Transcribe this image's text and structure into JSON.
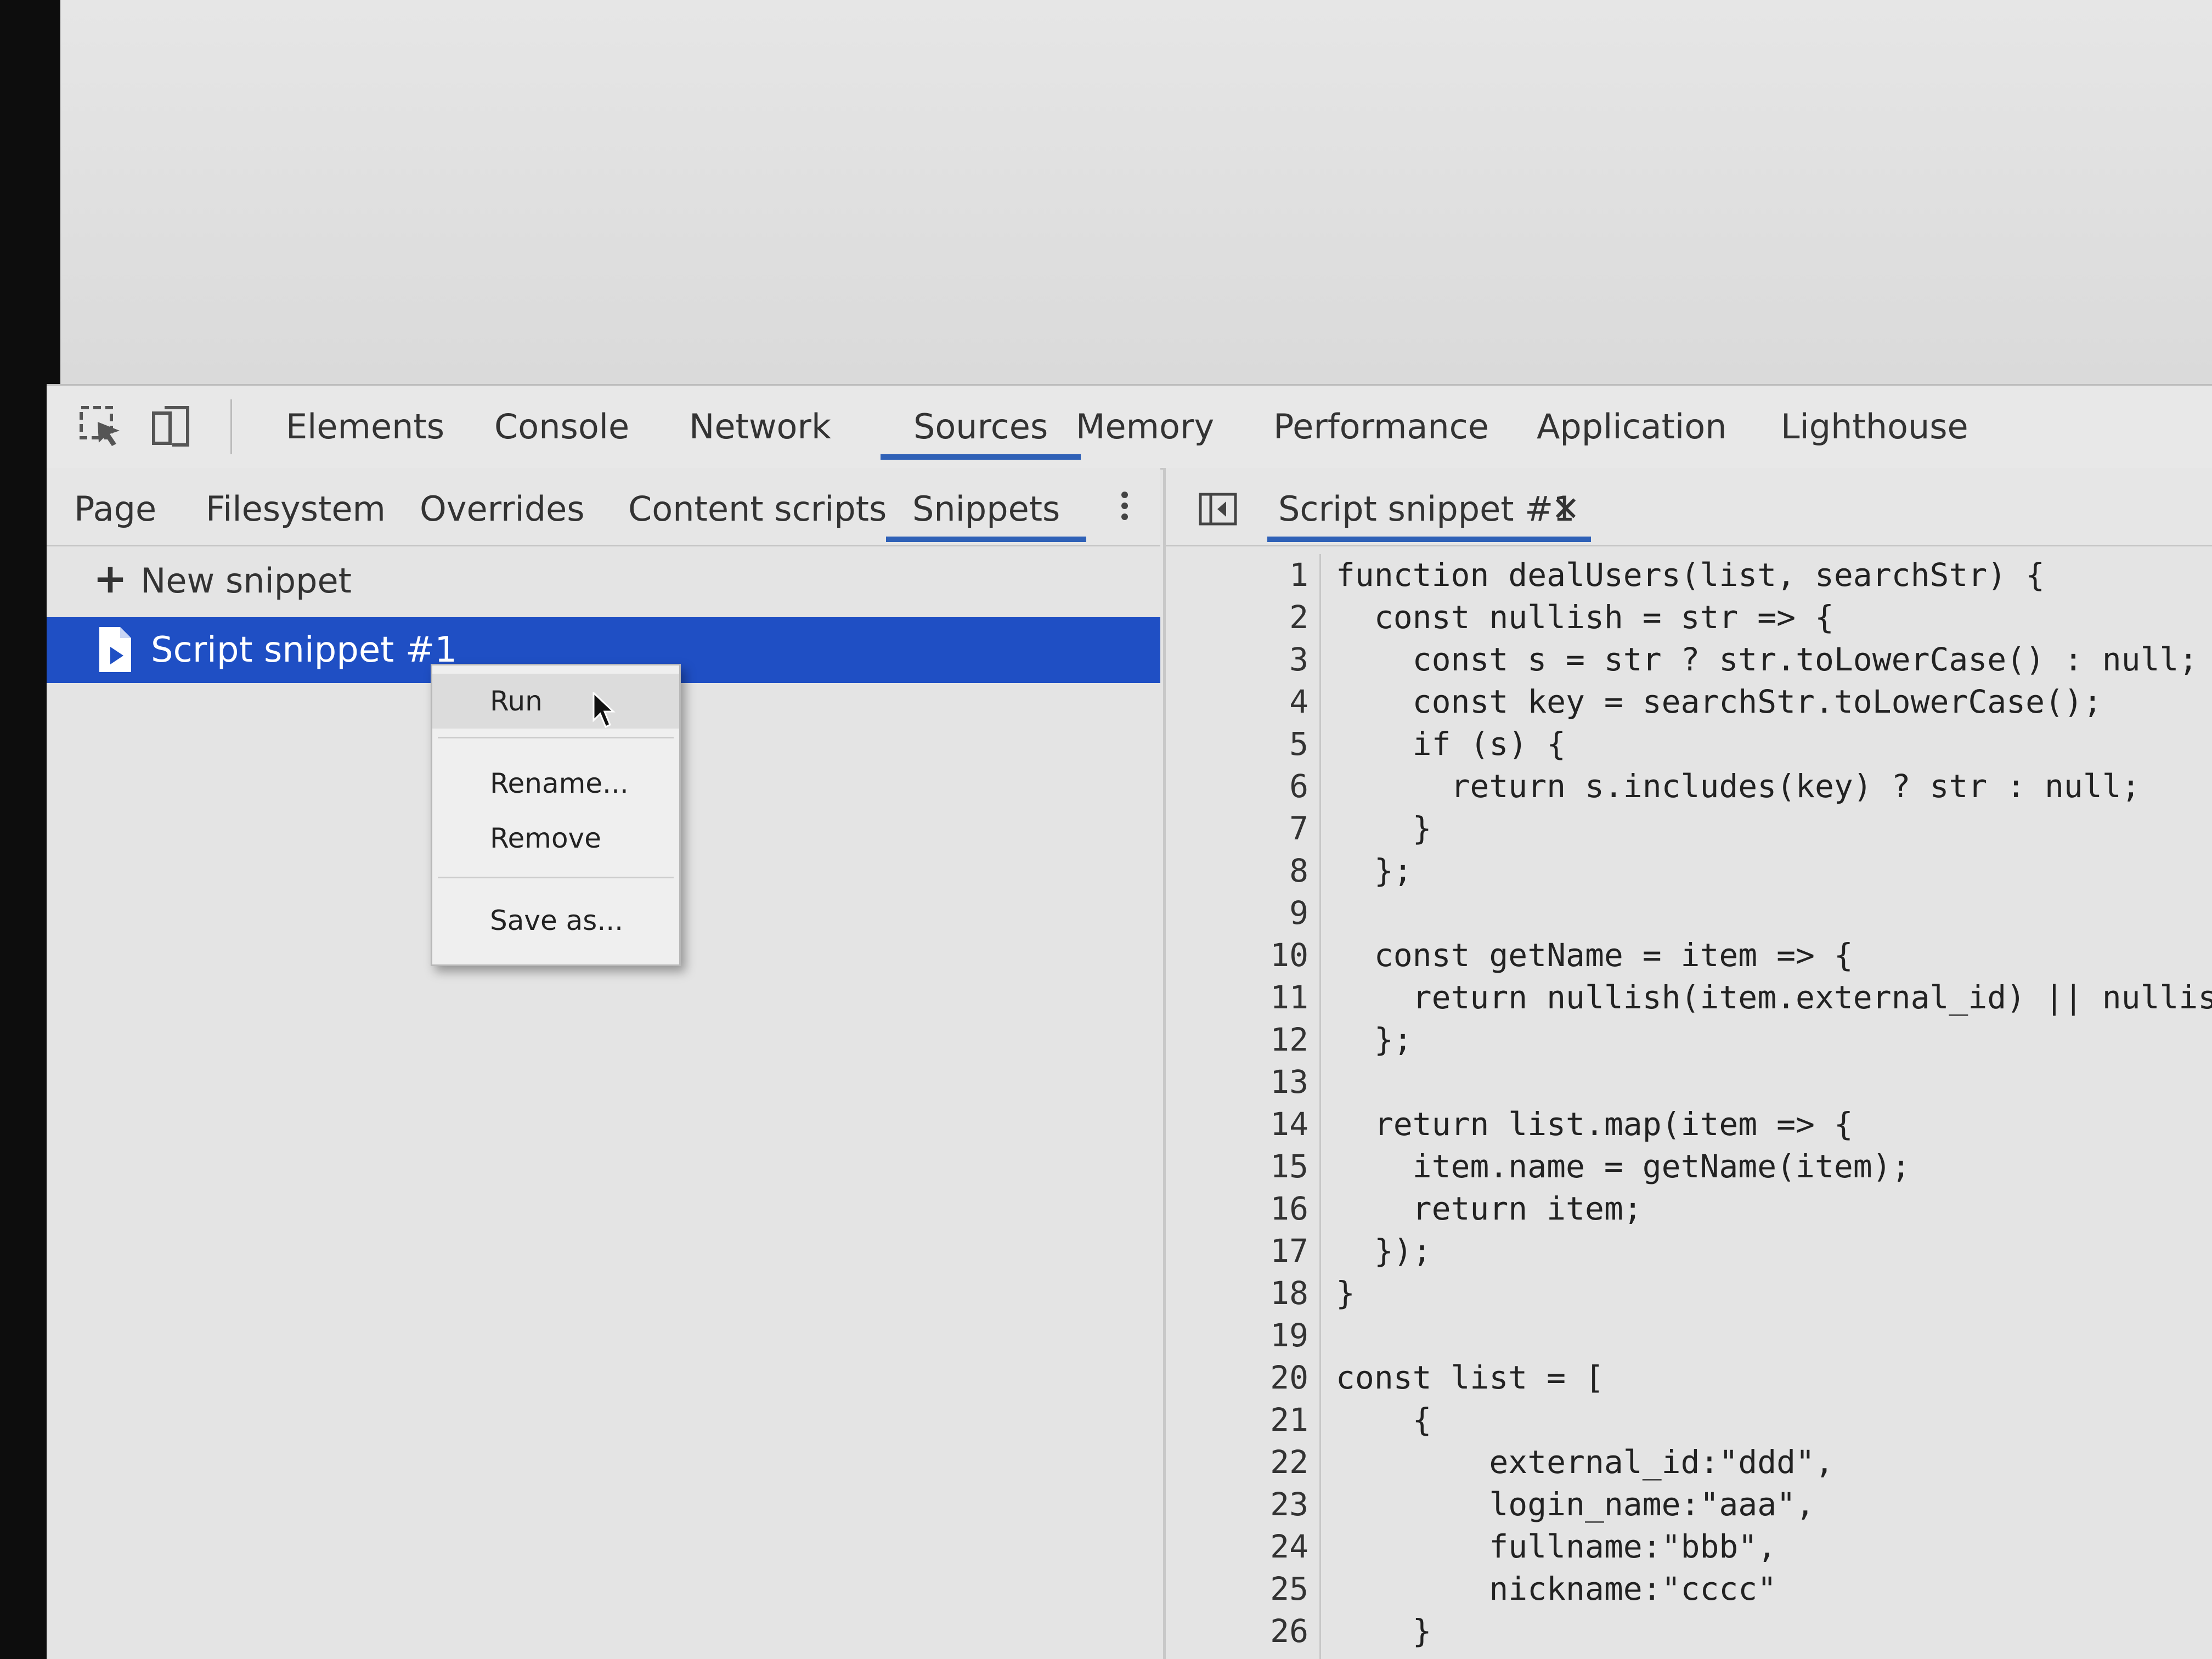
{
  "main_tabs": {
    "items": [
      {
        "label": "Elements"
      },
      {
        "label": "Console"
      },
      {
        "label": "Network"
      },
      {
        "label": "Sources"
      },
      {
        "label": "Memory"
      },
      {
        "label": "Performance"
      },
      {
        "label": "Application"
      },
      {
        "label": "Lighthouse"
      }
    ],
    "active": "Sources",
    "icons": [
      "inspect-element-icon",
      "device-toolbar-icon"
    ]
  },
  "navigator": {
    "tabs": [
      {
        "label": "Page"
      },
      {
        "label": "Filesystem"
      },
      {
        "label": "Overrides"
      },
      {
        "label": "Content scripts"
      },
      {
        "label": "Snippets"
      }
    ],
    "active": "Snippets",
    "new_snippet": {
      "icon": "+",
      "label": "New snippet"
    },
    "selected_snippet": "Script snippet #1"
  },
  "context_menu": {
    "items": [
      {
        "label": "Run"
      },
      {
        "label": "Rename..."
      },
      {
        "label": "Remove"
      },
      {
        "label": "Save as..."
      }
    ]
  },
  "editor": {
    "tab_label": "Script snippet #1",
    "close_glyph": "✕",
    "lines": [
      {
        "n": "1",
        "t": "function dealUsers(list, searchStr) {"
      },
      {
        "n": "2",
        "t": "  const nullish = str => {"
      },
      {
        "n": "3",
        "t": "    const s = str ? str.toLowerCase() : null;"
      },
      {
        "n": "4",
        "t": "    const key = searchStr.toLowerCase();"
      },
      {
        "n": "5",
        "t": "    if (s) {"
      },
      {
        "n": "6",
        "t": "      return s.includes(key) ? str : null;"
      },
      {
        "n": "7",
        "t": "    }"
      },
      {
        "n": "8",
        "t": "  };"
      },
      {
        "n": "9",
        "t": ""
      },
      {
        "n": "10",
        "t": "  const getName = item => {"
      },
      {
        "n": "11",
        "t": "    return nullish(item.external_id) || nullish("
      },
      {
        "n": "12",
        "t": "  };"
      },
      {
        "n": "13",
        "t": ""
      },
      {
        "n": "14",
        "t": "  return list.map(item => {"
      },
      {
        "n": "15",
        "t": "    item.name = getName(item);"
      },
      {
        "n": "16",
        "t": "    return item;"
      },
      {
        "n": "17",
        "t": "  });"
      },
      {
        "n": "18",
        "t": "}"
      },
      {
        "n": "19",
        "t": ""
      },
      {
        "n": "20",
        "t": "const list = ["
      },
      {
        "n": "21",
        "t": "    {"
      },
      {
        "n": "22",
        "t": "        external_id:\"ddd\","
      },
      {
        "n": "23",
        "t": "        login_name:\"aaa\","
      },
      {
        "n": "24",
        "t": "        fullname:\"bbb\","
      },
      {
        "n": "25",
        "t": "        nickname:\"cccc\""
      },
      {
        "n": "26",
        "t": "    }"
      }
    ]
  },
  "colors": {
    "accent": "#2f61b7",
    "selection": "#1f4fc4"
  }
}
